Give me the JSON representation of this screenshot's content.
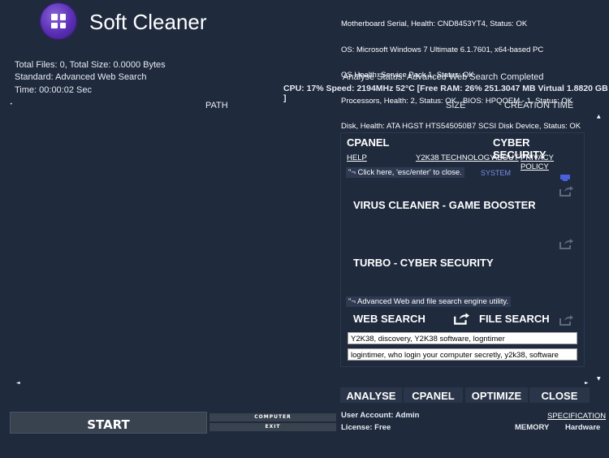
{
  "app": {
    "title": "Soft Cleaner"
  },
  "sysinfo": {
    "lines": [
      "Motherboard Serial, Health: CND8453YT4, Status: OK",
      "OS: Microsoft Windows 7 Ultimate 6.1.7601, x64-based PC",
      "OS Health: Service Pack 1, Status: OK",
      "Processors, Health: 2, Status: OK   BIOS: HPQOEM - 1, Status: OK",
      "Disk, Health: ATA HGST HTS545050B7 SCSI Disk Device, Status: OK"
    ]
  },
  "stats": {
    "total": "Total Files: 0, Total Size: 0.0000 Bytes",
    "standard": "Standard: Advanced Web Search",
    "time": "Time: 00:00:02 Sec",
    "analyse_status": "Analyse Status: Advanced Web Search Completed",
    "perf": "CPU: 17% Speed: 2194MHz 52°C [Free RAM: 26% 251.3047 MB Virtual 1.8820 GB ]"
  },
  "table": {
    "columns": [
      "PATH",
      "SIZE",
      "CREATION TIME"
    ]
  },
  "cpanel": {
    "title": "CPANEL",
    "subtitle": "CYBER SECURITY",
    "links": [
      "HELP",
      "Y2K38 TECHNOLOGY",
      "ABOUT",
      "PRIVACY POLICY"
    ],
    "hint": "\"¬ Click here, 'esc/enter' to close.",
    "system": "SYSTEM",
    "feature1": "VIRUS CLEANER - GAME BOOSTER",
    "feature2": "TURBO - CYBER SECURITY",
    "engine_hint": "\"¬ Advanced Web and file search engine utility.",
    "web_search": "WEB SEARCH",
    "file_search": "FILE SEARCH",
    "field1": "Y2K38, discovery, Y2K38 software, logntimer",
    "field2": "logintimer, who login your computer secretly, y2k38, software"
  },
  "actions": {
    "analyse": "ANALYSE",
    "cpanel": "CPANEL",
    "optimize": "OPTIMIZE",
    "close": "CLOSE"
  },
  "bottom": {
    "start": "START",
    "computer": "COMPUTER",
    "exit": "EXIT",
    "user": "User Account: Admin",
    "license": "License: Free",
    "specification": "SPECIFICATION",
    "memory": "MEMORY",
    "hardware": "Hardware"
  },
  "colors": {
    "background": "#1f2a3d",
    "accent": "#5a2fb5",
    "button": "#2a3549"
  }
}
